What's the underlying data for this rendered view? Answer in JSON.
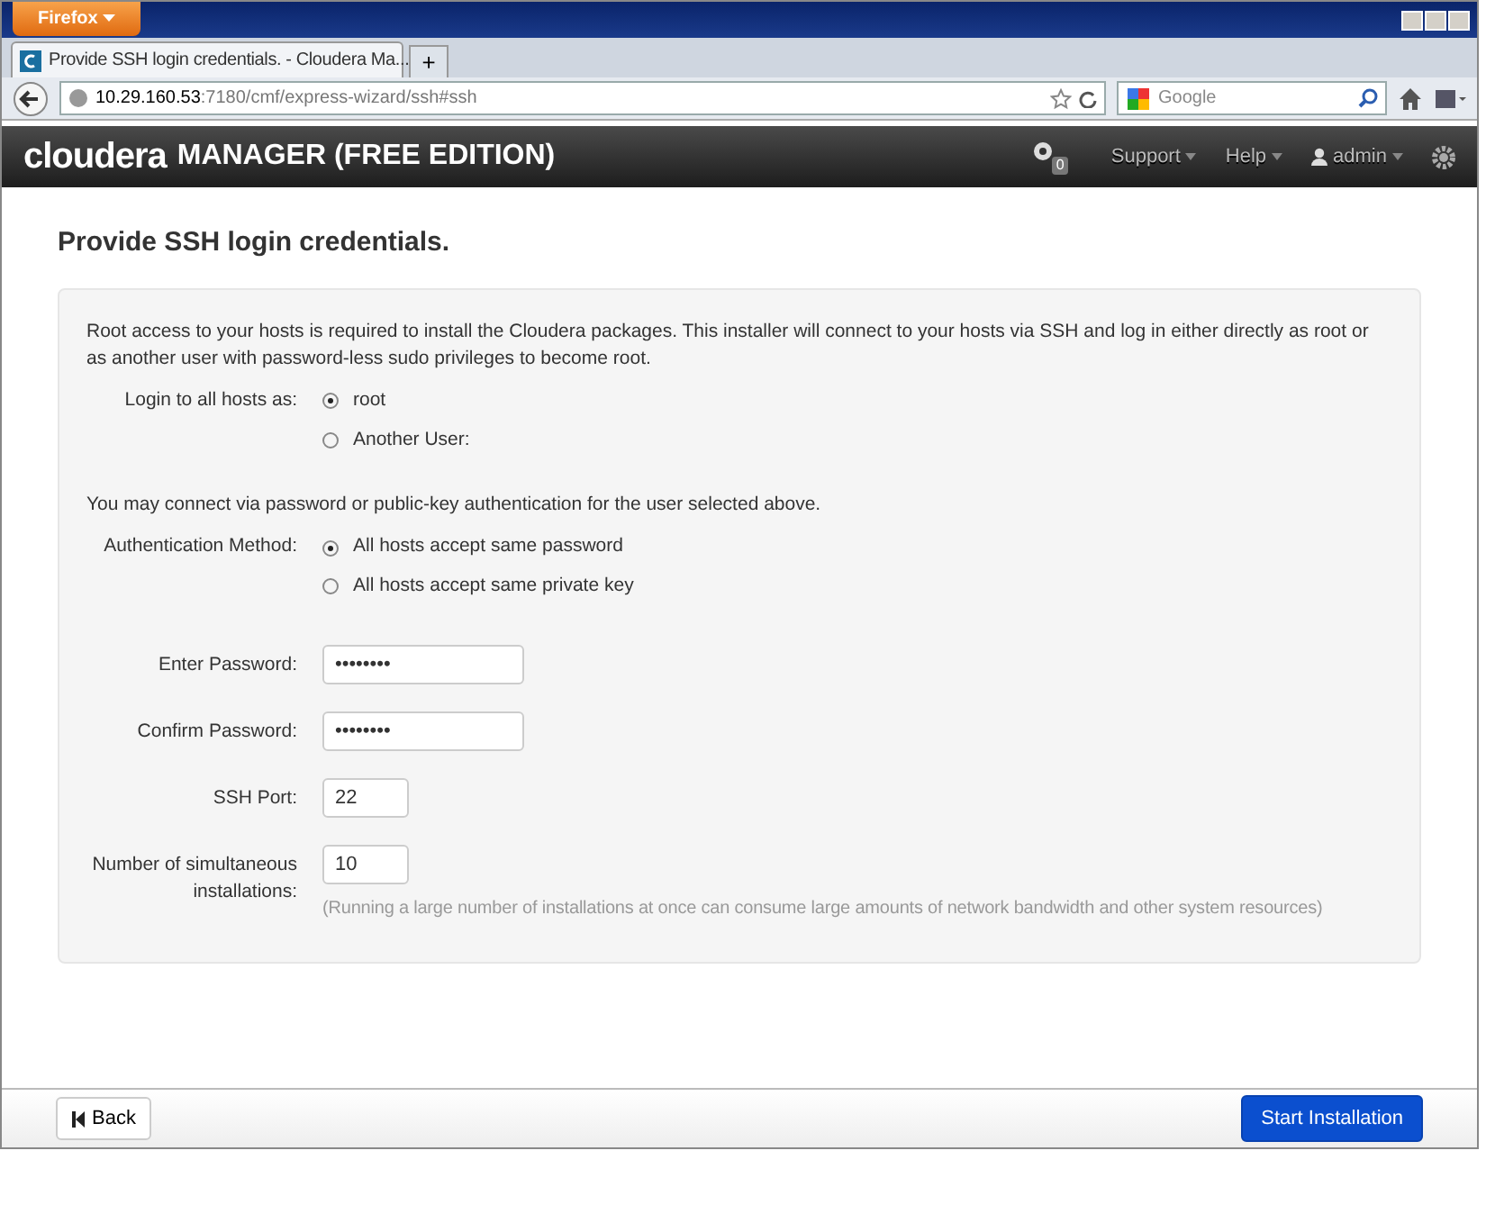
{
  "browser": {
    "menu_button": "Firefox",
    "tab": {
      "title": "Provide SSH login credentials. - Cloudera Ma..."
    },
    "new_tab": "+",
    "url": {
      "host": "10.29.160.53",
      "path": ":7180/cmf/express-wizard/ssh#ssh"
    },
    "search": {
      "placeholder": "Google"
    }
  },
  "app": {
    "brand": "cloudera",
    "product": "MANAGER (FREE EDITION)",
    "notifications": "0",
    "menus": [
      {
        "label": "Support",
        "kind": "menu"
      },
      {
        "label": "Help",
        "kind": "menu"
      },
      {
        "label": "admin",
        "kind": "user"
      }
    ]
  },
  "page": {
    "title": "Provide SSH login credentials.",
    "intro": "Root access to your hosts is required to install the Cloudera packages. This installer will connect to your hosts via SSH and log in either directly as root or as another user with password-less sudo privileges to become root.",
    "login_as": {
      "label": "Login to all hosts as:",
      "options": [
        {
          "label": "root",
          "selected": true
        },
        {
          "label": "Another User:",
          "selected": false
        }
      ]
    },
    "auth_note": "You may connect via password or public-key authentication for the user selected above.",
    "auth_method": {
      "label": "Authentication Method:",
      "options": [
        {
          "label": "All hosts accept same password",
          "selected": true
        },
        {
          "label": "All hosts accept same private key",
          "selected": false
        }
      ]
    },
    "fields": [
      {
        "label": "Enter Password:",
        "value": "••••••••",
        "kind": "wide"
      },
      {
        "label": "Confirm Password:",
        "value": "••••••••",
        "kind": "wide"
      },
      {
        "label": "SSH Port:",
        "value": "22",
        "kind": "narrow"
      },
      {
        "label": "Number of simultaneous installations:",
        "value": "10",
        "kind": "narrow",
        "hint": "(Running a large number of installations at once can consume large amounts of network bandwidth and other system resources)"
      }
    ]
  },
  "footer": {
    "back": "Back",
    "start": "Start Installation"
  }
}
